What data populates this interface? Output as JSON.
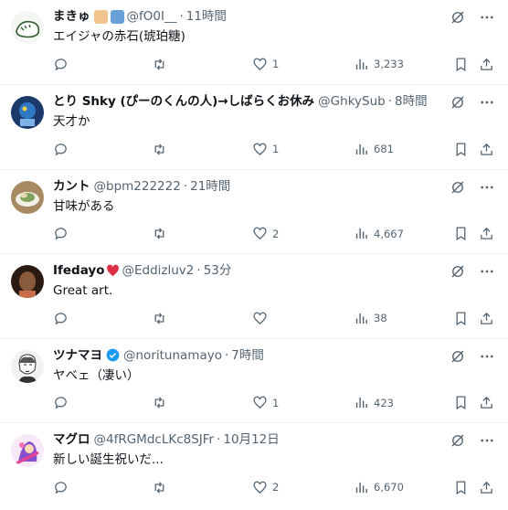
{
  "replies": [
    {
      "name": "まきゅ",
      "handle": "@fO0I__",
      "time": "11時間",
      "text": "エイジャの赤石(琥珀糖)",
      "counts": {
        "reply": "",
        "retweet": "",
        "like": "1",
        "views": "3,233"
      },
      "avatar_color": "#dfe6d8",
      "emojis": [
        "palette-emoji",
        "books-emoji"
      ]
    },
    {
      "name": "とり Shky (ぴーのくんの人)→しばらくお休み",
      "handle": "@GhkySub",
      "time": "8時間",
      "text": "天才か",
      "counts": {
        "reply": "",
        "retweet": "",
        "like": "1",
        "views": "681"
      },
      "avatar_color": "#1b3a6b",
      "emojis": []
    },
    {
      "name": "カント",
      "handle": "@bpm222222",
      "time": "21時間",
      "text": "甘味がある",
      "counts": {
        "reply": "",
        "retweet": "",
        "like": "2",
        "views": "4,667"
      },
      "avatar_color": "#c7b79a",
      "emojis": []
    },
    {
      "name": "Ifedayo",
      "handle": "@Eddizluv2",
      "time": "53分",
      "text": "Great art.",
      "counts": {
        "reply": "",
        "retweet": "",
        "like": "",
        "views": "38"
      },
      "avatar_color": "#5b3a2a",
      "emojis": [
        "red-heart-emoji"
      ]
    },
    {
      "name": "ツナマヨ",
      "handle": "@noritunamayo",
      "time": "7時間",
      "text": "ヤベェ（凄い）",
      "counts": {
        "reply": "",
        "retweet": "",
        "like": "1",
        "views": "423"
      },
      "avatar_color": "#e8e8e8",
      "emojis": [],
      "verified": true
    },
    {
      "name": "マグロ",
      "handle": "@4fRGMdcLKc8SJFr",
      "time": "10月12日",
      "text": "新しい誕生祝いだ...",
      "counts": {
        "reply": "",
        "retweet": "",
        "like": "2",
        "views": "6,670"
      },
      "avatar_color": "#8a4fd1",
      "emojis": []
    }
  ],
  "separator": "·",
  "colors": {
    "text": "#0f1419",
    "muted": "#536471",
    "border": "#eff3f4",
    "verified": "#1d9bf0",
    "heart": "#f91880"
  }
}
